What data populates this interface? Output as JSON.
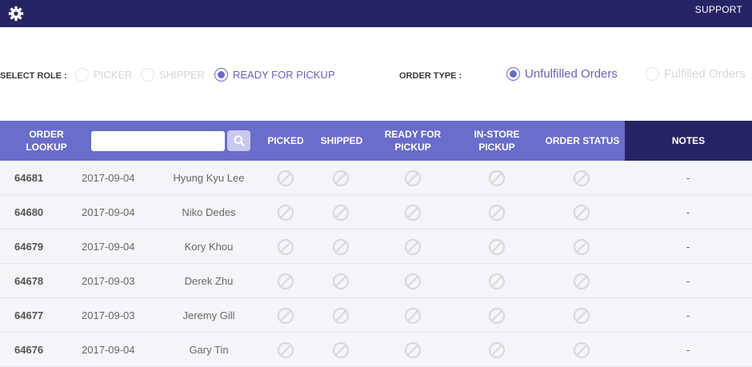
{
  "header": {
    "settings_icon": "gear-icon",
    "support_label": "SUPPORT"
  },
  "filters": {
    "role_label": "SELECT ROLE :",
    "roles": [
      {
        "label": "PICKER",
        "selected": false
      },
      {
        "label": "SHIPPER",
        "selected": false
      },
      {
        "label": "READY FOR PICKUP",
        "selected": true
      }
    ],
    "order_type_label": "ORDER TYPE :",
    "order_types": [
      {
        "label": "Unfulfilled Orders",
        "selected": true
      },
      {
        "label": "Fulfilled Orders",
        "selected": false
      }
    ]
  },
  "table": {
    "lookup_label": "ORDER LOOKUP",
    "search": {
      "value": "",
      "placeholder": "",
      "icon": "search-icon"
    },
    "columns": {
      "picked": "PICKED",
      "shipped": "SHIPPED",
      "ready_for_pickup": "READY FOR PICKUP",
      "in_store_pickup": "IN-STORE PICKUP",
      "order_status": "ORDER STATUS",
      "notes": "NOTES"
    },
    "status_icon": "not-allowed-icon",
    "rows": [
      {
        "id": "64681",
        "date": "2017-09-04",
        "name": "Hyung Kyu Lee",
        "notes": "-"
      },
      {
        "id": "64680",
        "date": "2017-09-04",
        "name": "Niko Dedes",
        "notes": "-"
      },
      {
        "id": "64679",
        "date": "2017-09-04",
        "name": "Kory Khou",
        "notes": "-"
      },
      {
        "id": "64678",
        "date": "2017-09-03",
        "name": "Derek Zhu",
        "notes": "-"
      },
      {
        "id": "64677",
        "date": "2017-09-03",
        "name": "Jeremy Gill",
        "notes": "-"
      },
      {
        "id": "64676",
        "date": "2017-09-04",
        "name": "Gary Tin",
        "notes": "-"
      }
    ]
  },
  "colors": {
    "topbar": "#262463",
    "table_header": "#6a6dc9",
    "accent": "#6463bd",
    "row_background": "#f4f5f8"
  }
}
